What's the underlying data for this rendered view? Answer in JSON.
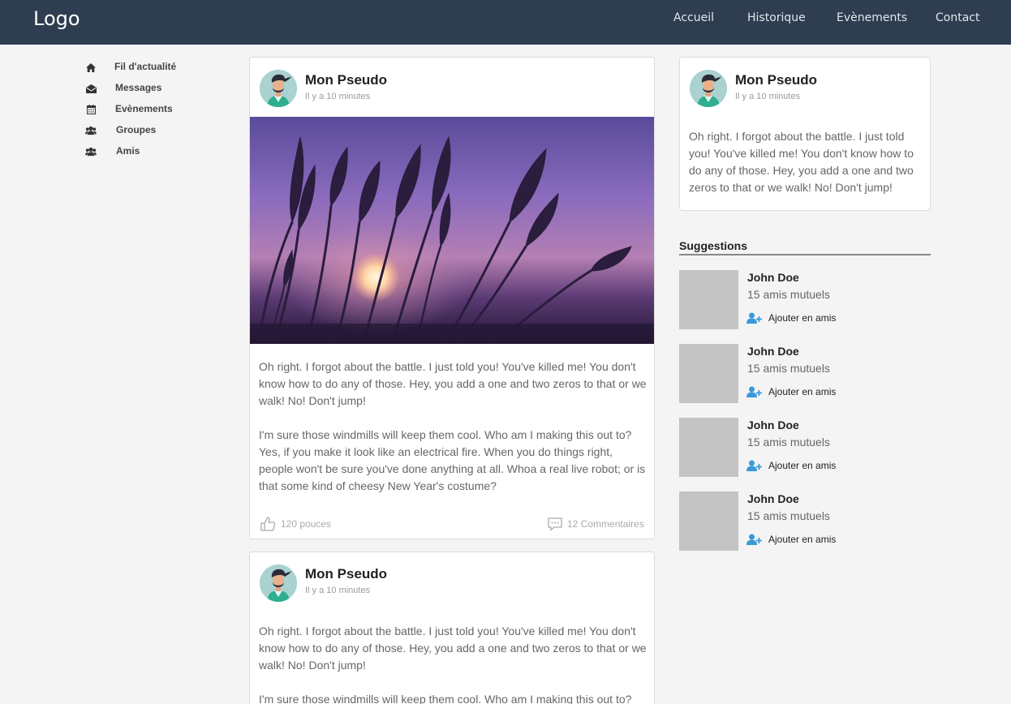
{
  "header": {
    "logo": "Logo",
    "nav": [
      "Accueil",
      "Historique",
      "Evènements",
      "Contact"
    ]
  },
  "sidebar": {
    "items": [
      {
        "label": "Fil d'actualité",
        "icon": "home-icon"
      },
      {
        "label": "Messages",
        "icon": "envelope-icon"
      },
      {
        "label": "Evènements",
        "icon": "calendar-icon"
      },
      {
        "label": "Groupes",
        "icon": "users-icon"
      },
      {
        "label": "Amis",
        "icon": "users-icon"
      }
    ]
  },
  "posts": [
    {
      "author": "Mon Pseudo",
      "time": "Il y a 10 minutes",
      "paragraphs": [
        "Oh right. I forgot about the battle. I just told you! You've killed me! You don't know how to do any of those. Hey, you add a one and two zeros to that or we walk! No! Don't jump!",
        "I'm sure those windmills will keep them cool. Who am I making this out to? Yes, if you make it look like an electrical fire. When you do things right, people won't be sure you've done anything at all. Whoa a real live robot; or is that some kind of cheesy New Year's costume?"
      ],
      "likes": "120 pouces",
      "comments": "12 Commentaires"
    },
    {
      "author": "Mon Pseudo",
      "time": "Il y a 10 minutes",
      "paragraphs": [
        "Oh right. I forgot about the battle. I just told you! You've killed me! You don't know how to do any of those. Hey, you add a one and two zeros to that or we walk! No! Don't jump!",
        "I'm sure those windmills will keep them cool. Who am I making this out to?"
      ]
    }
  ],
  "profile_card": {
    "author": "Mon Pseudo",
    "time": "Il y a 10 minutes",
    "text": "Oh right. I forgot about the battle. I just told you! You've killed me! You don't know how to do any of those. Hey, you add a one and two zeros to that or we walk! No! Don't jump!"
  },
  "suggestions": {
    "title": "Suggestions",
    "items": [
      {
        "name": "John Doe",
        "mutual": "15 amis mutuels",
        "action": "Ajouter en amis"
      },
      {
        "name": "John Doe",
        "mutual": "15 amis mutuels",
        "action": "Ajouter en amis"
      },
      {
        "name": "John Doe",
        "mutual": "15 amis mutuels",
        "action": "Ajouter en amis"
      },
      {
        "name": "John Doe",
        "mutual": "15 amis mutuels",
        "action": "Ajouter en amis"
      }
    ]
  },
  "colors": {
    "header_bg": "#2e3d50",
    "page_bg": "#f4f4f4",
    "accent": "#3a9ad9"
  }
}
